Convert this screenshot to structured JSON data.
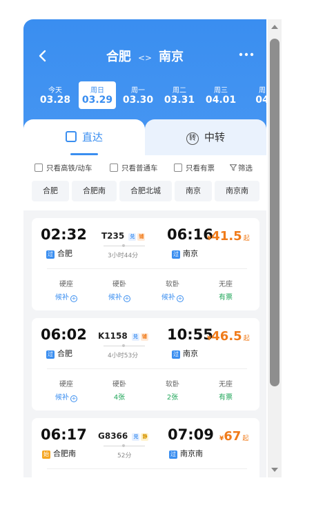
{
  "header": {
    "back_icon": "chevron-left-icon",
    "from": "合肥",
    "arrow": "<>",
    "to": "南京",
    "more_icon": "more-dots-icon",
    "color": "#3a8ef0"
  },
  "dates": [
    {
      "day": "今天",
      "date": "03.28"
    },
    {
      "day": "周日",
      "date": "03.29"
    },
    {
      "day": "周一",
      "date": "03.30"
    },
    {
      "day": "周二",
      "date": "03.31"
    },
    {
      "day": "周三",
      "date": "04.01"
    },
    {
      "day": "周",
      "date": "04"
    }
  ],
  "tabs": {
    "direct": "直达",
    "transfer": "中转",
    "transfer_icon_text": "转"
  },
  "filters": {
    "highspeed": "只看高铁/动车",
    "normal": "只看普通车",
    "available": "只看有票",
    "filter": "筛选"
  },
  "stations": [
    "合肥",
    "合肥南",
    "合肥北城",
    "南京",
    "南京南"
  ],
  "trains": [
    {
      "depart_time": "02:32",
      "depart_tag": "过",
      "depart_station": "合肥",
      "train_no": "T235",
      "badges": [
        "兑",
        "铺"
      ],
      "duration": "3小时44分",
      "arrive_time": "06:16",
      "arrive_tag": "过",
      "arrive_station": "南京",
      "price_symbol": "¥",
      "price": "41.5",
      "price_suffix": "起",
      "seats": [
        {
          "name": "硬座",
          "value": "候补",
          "plus": "+"
        },
        {
          "name": "硬卧",
          "value": "候补",
          "plus": "+"
        },
        {
          "name": "软卧",
          "value": "候补",
          "plus": "+"
        },
        {
          "name": "无座",
          "value": "有票"
        }
      ]
    },
    {
      "depart_time": "06:02",
      "depart_tag": "过",
      "depart_station": "合肥",
      "train_no": "K1158",
      "badges": [
        "兑",
        "铺"
      ],
      "duration": "4小时53分",
      "arrive_time": "10:55",
      "arrive_tag": "过",
      "arrive_station": "南京",
      "price_symbol": "¥",
      "price": "46.5",
      "price_suffix": "起",
      "seats": [
        {
          "name": "硬座",
          "value": "候补",
          "plus": "+"
        },
        {
          "name": "硬卧",
          "value": "4张"
        },
        {
          "name": "软卧",
          "value": "2张"
        },
        {
          "name": "无座",
          "value": "有票"
        }
      ]
    },
    {
      "depart_time": "06:17",
      "depart_tag": "始",
      "depart_station": "合肥南",
      "train_no": "G8366",
      "badges": [
        "兑",
        "静"
      ],
      "duration": "52分",
      "arrive_time": "07:09",
      "arrive_tag": "过",
      "arrive_station": "南京南",
      "price_symbol": "¥",
      "price": "67",
      "price_suffix": "起"
    }
  ]
}
